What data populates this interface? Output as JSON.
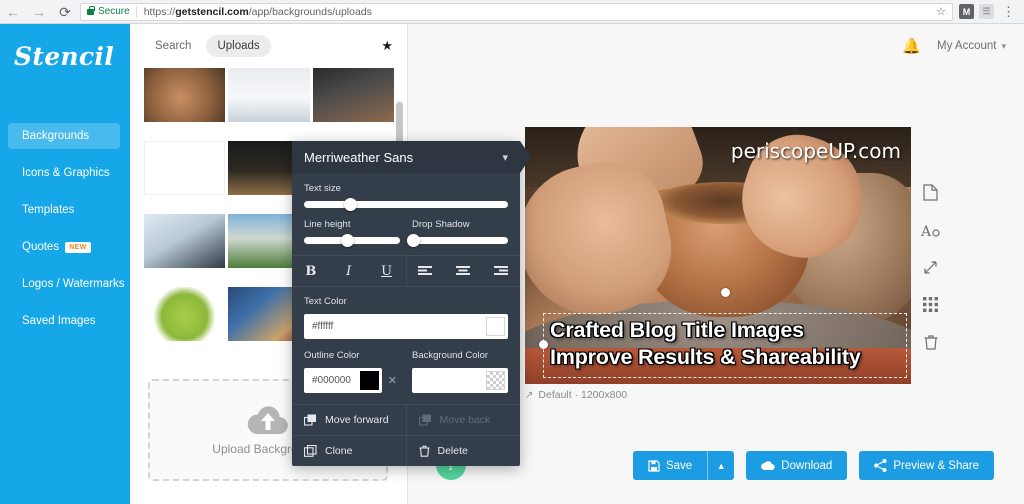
{
  "browser": {
    "back_icon": "arrow-left-icon",
    "forward_icon": "arrow-right-icon",
    "reload_icon": "reload-icon",
    "secure_label": "Secure",
    "url_scheme": "https://",
    "url_domain": "getstencil.com",
    "url_path": "/app/backgrounds/uploads",
    "bookmark_icon": "star-icon",
    "extension_1": "M",
    "extension_2": "",
    "menu_icon": "kebab-menu-icon"
  },
  "sidebar": {
    "logo": "Stencil",
    "items": [
      {
        "label": "Backgrounds",
        "active": true,
        "badge": ""
      },
      {
        "label": "Icons & Graphics",
        "active": false,
        "badge": ""
      },
      {
        "label": "Templates",
        "active": false,
        "badge": ""
      },
      {
        "label": "Quotes",
        "active": false,
        "badge": "NEW"
      },
      {
        "label": "Logos / Watermarks",
        "active": false,
        "badge": ""
      },
      {
        "label": "Saved Images",
        "active": false,
        "badge": ""
      }
    ],
    "accent_color": "#16a7e8"
  },
  "library": {
    "tabs": [
      {
        "label": "Search",
        "active": false
      },
      {
        "label": "Uploads",
        "active": true
      }
    ],
    "favorite_icon": "star-filled-icon",
    "thumbnails": [
      {
        "alt": "hands-shaping-clay-pot"
      },
      {
        "alt": "google-logo-on-whiteboard"
      },
      {
        "alt": "smartphone-and-microphone"
      },
      {
        "alt": "pixel-hand-cursor"
      },
      {
        "alt": "green-apple-and-pencil-cup"
      },
      {
        "alt": "green-apple-and-pencil-cup-2"
      },
      {
        "alt": "hand-on-computer-mouse"
      },
      {
        "alt": "white-house-building"
      },
      {
        "alt": "person-in-snow-winter"
      },
      {
        "alt": "green-apple-world-map"
      },
      {
        "alt": "colorful-art-supplies"
      }
    ],
    "upload_zone": {
      "label": "Upload Backgrounds",
      "icon": "cloud-upload-icon"
    }
  },
  "topbar": {
    "notifications_icon": "bell-icon",
    "account_label": "My Account",
    "account_caret_icon": "chevron-down-icon"
  },
  "canvas": {
    "watermark": "periscopeUP.com",
    "headline_line1": "Crafted Blog Title Images",
    "headline_line2": "Improve Results & Shareability",
    "meta_icon": "resize-icon",
    "meta_label": "Default · 1200x800",
    "background_alt": "potter-shaping-clay-pot-on-wheel"
  },
  "tool_rail": [
    {
      "name": "page-icon"
    },
    {
      "name": "text-icon"
    },
    {
      "name": "resize-icon"
    },
    {
      "name": "grid-icon"
    },
    {
      "name": "trash-icon"
    }
  ],
  "actions": {
    "save_label": "Save",
    "save_icon": "save-icon",
    "save_caret_icon": "chevron-up-icon",
    "download_label": "Download",
    "download_icon": "cloud-download-icon",
    "preview_label": "Preview & Share",
    "preview_icon": "share-icon",
    "help_label": "?",
    "button_color": "#1b9ce3",
    "help_color": "#54d6a0"
  },
  "font_panel": {
    "font_name": "Merriweather Sans",
    "collapse_icon": "chevron-down-icon",
    "text_size_label": "Text size",
    "text_size_value": 23,
    "line_height_label": "Line height",
    "line_height_value": 45,
    "drop_shadow_label": "Drop Shadow",
    "drop_shadow_value": 2,
    "bold_label": "B",
    "italic_label": "I",
    "underline_label": "U",
    "align_left_icon": "align-left-icon",
    "align_center_icon": "align-center-icon",
    "align_right_icon": "align-right-icon",
    "text_color_label": "Text Color",
    "text_color_value": "#ffffff",
    "outline_color_label": "Outline Color",
    "outline_color_value": "#000000",
    "background_color_label": "Background Color",
    "background_color_value": "",
    "clear_bg_icon": "close-icon",
    "menu": {
      "move_forward": "Move forward",
      "move_back": "Move back",
      "clone": "Clone",
      "delete": "Delete"
    }
  }
}
